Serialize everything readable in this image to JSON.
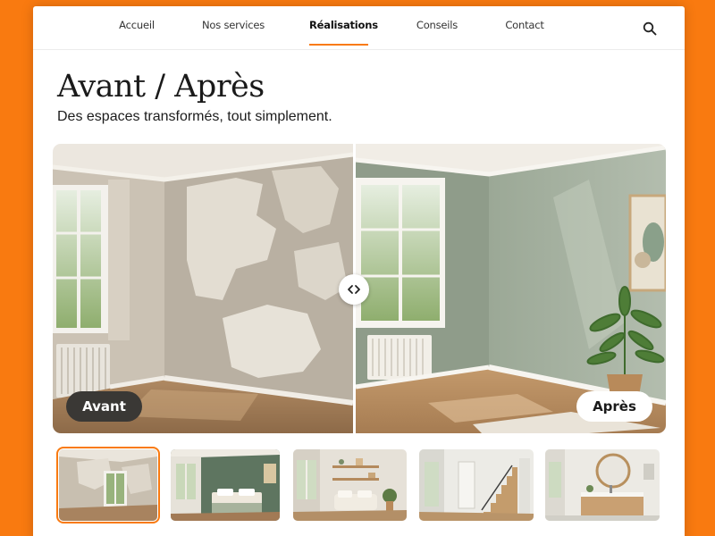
{
  "nav": {
    "items": [
      {
        "label": "Accueil"
      },
      {
        "label": "Nos services"
      },
      {
        "label": "Réalisations"
      },
      {
        "label": "Conseils"
      },
      {
        "label": "Contact"
      }
    ],
    "active_index": 2,
    "search_icon": "search-icon"
  },
  "hero": {
    "title": "Avant / Après",
    "subtitle": "Des espaces transformés, tout simplement."
  },
  "comparison": {
    "before_label": "Avant",
    "after_label": "Après",
    "handle_icon": "chevrons-left-right-icon"
  },
  "thumbnails": {
    "selected_index": 0,
    "items": [
      {
        "icon": "before-room-thumbnail"
      },
      {
        "icon": "bedroom-thumbnail"
      },
      {
        "icon": "living-room-thumbnail"
      },
      {
        "icon": "staircase-thumbnail"
      },
      {
        "icon": "bathroom-thumbnail"
      }
    ]
  },
  "colors": {
    "accent": "#f97a10",
    "background": "#f97a10",
    "before_badge": "#3a3835",
    "after_badge": "#ffffff"
  }
}
